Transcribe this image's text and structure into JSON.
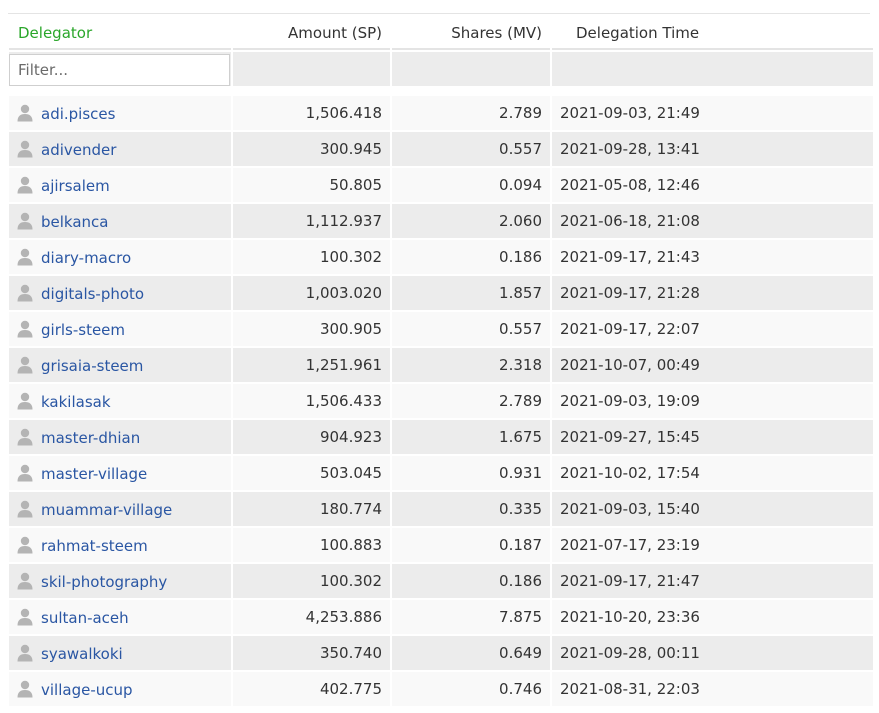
{
  "header": {
    "delegator": "Delegator",
    "amount": "Amount (SP)",
    "shares": "Shares (MV)",
    "time": "Delegation Time"
  },
  "filter": {
    "placeholder": "Filter..."
  },
  "colors": {
    "header_accent": "#2aa62a",
    "link": "#2a56a3",
    "row_alt": "#ececec",
    "row_base": "#f9f9f9"
  },
  "rows": [
    {
      "delegator": "adi.pisces",
      "amount": "1,506.418",
      "shares": "2.789",
      "time": "2021-09-03, 21:49"
    },
    {
      "delegator": "adivender",
      "amount": "300.945",
      "shares": "0.557",
      "time": "2021-09-28, 13:41"
    },
    {
      "delegator": "ajirsalem",
      "amount": "50.805",
      "shares": "0.094",
      "time": "2021-05-08, 12:46"
    },
    {
      "delegator": "belkanca",
      "amount": "1,112.937",
      "shares": "2.060",
      "time": "2021-06-18, 21:08"
    },
    {
      "delegator": "diary-macro",
      "amount": "100.302",
      "shares": "0.186",
      "time": "2021-09-17, 21:43"
    },
    {
      "delegator": "digitals-photo",
      "amount": "1,003.020",
      "shares": "1.857",
      "time": "2021-09-17, 21:28"
    },
    {
      "delegator": "girls-steem",
      "amount": "300.905",
      "shares": "0.557",
      "time": "2021-09-17, 22:07"
    },
    {
      "delegator": "grisaia-steem",
      "amount": "1,251.961",
      "shares": "2.318",
      "time": "2021-10-07, 00:49"
    },
    {
      "delegator": "kakilasak",
      "amount": "1,506.433",
      "shares": "2.789",
      "time": "2021-09-03, 19:09"
    },
    {
      "delegator": "master-dhian",
      "amount": "904.923",
      "shares": "1.675",
      "time": "2021-09-27, 15:45"
    },
    {
      "delegator": "master-village",
      "amount": "503.045",
      "shares": "0.931",
      "time": "2021-10-02, 17:54"
    },
    {
      "delegator": "muammar-village",
      "amount": "180.774",
      "shares": "0.335",
      "time": "2021-09-03, 15:40"
    },
    {
      "delegator": "rahmat-steem",
      "amount": "100.883",
      "shares": "0.187",
      "time": "2021-07-17, 23:19"
    },
    {
      "delegator": "skil-photography",
      "amount": "100.302",
      "shares": "0.186",
      "time": "2021-09-17, 21:47"
    },
    {
      "delegator": "sultan-aceh",
      "amount": "4,253.886",
      "shares": "7.875",
      "time": "2021-10-20, 23:36"
    },
    {
      "delegator": "syawalkoki",
      "amount": "350.740",
      "shares": "0.649",
      "time": "2021-09-28, 00:11"
    },
    {
      "delegator": "village-ucup",
      "amount": "402.775",
      "shares": "0.746",
      "time": "2021-08-31, 22:03"
    }
  ],
  "row_icon": "user-icon"
}
